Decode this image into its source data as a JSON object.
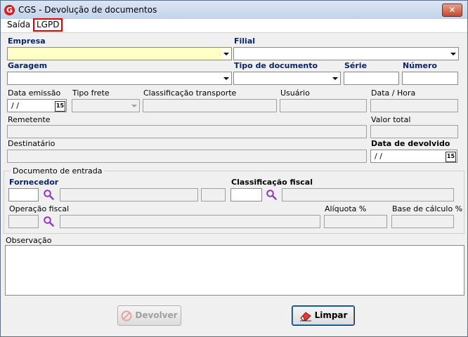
{
  "window": {
    "title": "CGS - Devolução de documentos",
    "close_symbol": "✕",
    "logo_letter": "G"
  },
  "menu": [
    {
      "label": "Saída"
    },
    {
      "label": "LGPD"
    }
  ],
  "fields": {
    "empresa": "Empresa",
    "filial": "Filial",
    "garagem": "Garagem",
    "tipo_documento": "Tipo de documento",
    "serie": "Série",
    "numero": "Número",
    "data_emissao": "Data emissão",
    "data_emissao_value": "/ /",
    "calendar_label": "15",
    "tipo_frete": "Tipo frete",
    "classificacao_transporte": "Classificação transporte",
    "usuario": "Usuário",
    "data_hora": "Data / Hora",
    "remetente": "Remetente",
    "valor_total": "Valor total",
    "destinatario": "Destinatário",
    "data_devolvido": "Data de devolvido",
    "data_devolvido_value": "/ /"
  },
  "documento_entrada": {
    "group_label": "Documento de entrada",
    "fornecedor": "Fornecedor",
    "classificacao_fiscal": "Classificação fiscal",
    "operacao_fiscal": "Operação fiscal",
    "aliquota": "Alíquota %",
    "base_calculo": "Base de cálculo %"
  },
  "observacao": "Observação",
  "buttons": {
    "devolver": "Devolver",
    "limpar": "Limpar"
  },
  "colors": {
    "lgpd_highlight": "#e00000",
    "empresa_field_bg": "#ffffc8",
    "search_icon": "#9b30c8"
  }
}
